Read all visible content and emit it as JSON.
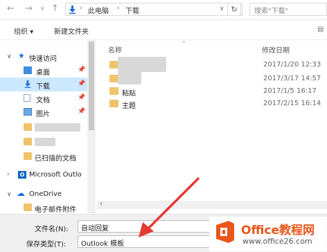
{
  "address_bar": {
    "path": [
      "此电脑",
      "下载"
    ],
    "search_placeholder": "搜索\"下载\""
  },
  "toolbar": {
    "organize_label": "组织 ▾",
    "new_folder_label": "新建文件夹",
    "view_icon": "▤"
  },
  "sidebar": {
    "quick_access_label": "快速访问",
    "items": [
      {
        "label": "桌面"
      },
      {
        "label": "下载"
      },
      {
        "label": "文档"
      },
      {
        "label": "图片"
      },
      {
        "label": "已扫描的文档"
      }
    ],
    "microsoft_outlook_label": "Microsoft Outlo",
    "onedrive_label": "OneDrive",
    "email_attachments_label": "电子邮件附件"
  },
  "file_list": {
    "columns": {
      "name": "名称",
      "modified": "修改日期"
    },
    "rows": [
      {
        "name": "",
        "date": "2017/1/20 12:33"
      },
      {
        "name": "",
        "date": "2017/3/17 14:57"
      },
      {
        "name": "粘贴",
        "date": "2017/1/5 16:17"
      },
      {
        "name": "主题",
        "date": "2017/2/15 16:14"
      }
    ]
  },
  "bottom": {
    "filename_label": "文件名(N):",
    "filename_value": "自动回复",
    "savetype_label": "保存类型(T):",
    "savetype_value": "Outlook 模板"
  },
  "watermark": {
    "title": "Office教程网",
    "url": "www.office26.com"
  },
  "colors": {
    "selected": "#cce8ff",
    "folder": "#f0c36a",
    "arrow": "#e53935",
    "brand": "#e8561b"
  }
}
